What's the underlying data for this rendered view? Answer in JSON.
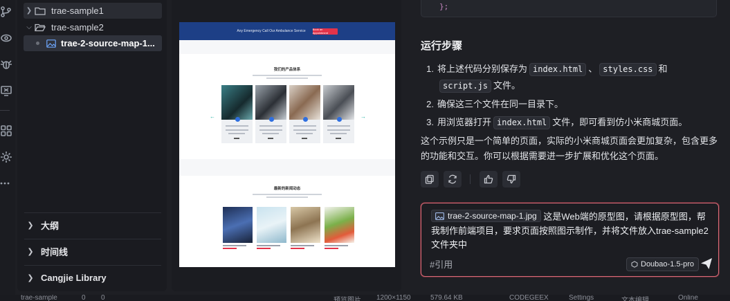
{
  "activity_bar": {
    "icons": [
      "branch-icon",
      "debug-run-icon",
      "bug-icon",
      "remote-icon",
      "extensions-icon",
      "settings-icon",
      "more-icon"
    ]
  },
  "explorer": {
    "items": [
      {
        "label": "trae-sample1",
        "type": "folder",
        "expanded": false
      },
      {
        "label": "trae-sample2",
        "type": "folder",
        "expanded": true
      },
      {
        "label": "trae-2-source-map-1...",
        "type": "image-file",
        "selected": true
      }
    ],
    "sections": [
      {
        "label": "大纲"
      },
      {
        "label": "时间线"
      },
      {
        "label": "Cangjie Library"
      }
    ]
  },
  "preview": {
    "banner_text": "Any Emergency Call Our Ambulance Service",
    "banner_button": "Book an Appointment",
    "products_title": "我们的产品体系",
    "news_title": "最新的新闻动态",
    "product_names": [
      "手术器械系列",
      "听诊器系列",
      "护理器械系列",
      "显微镜系列"
    ],
    "news_names": [
      "Daniel R. Bruce",
      "Clifford S. Holland",
      "Emily R. Shreeves",
      "Sandra A. Naffe"
    ]
  },
  "chat": {
    "code_tail": "};",
    "heading": "运行步骤",
    "steps": [
      {
        "num": "1.",
        "prefix": "将上述代码分别保存为",
        "code1": "index.html",
        "sep1": "、",
        "code2": "styles.css",
        "sep2": "和",
        "code3": "script.js",
        "suffix": "文件。"
      },
      {
        "num": "2.",
        "text": "确保这三个文件在同一目录下。"
      },
      {
        "num": "3.",
        "prefix": "用浏览器打开",
        "code": "index.html",
        "suffix": "文件，即可看到仿小米商城页面。"
      }
    ],
    "summary": "这个示例只是一个简单的页面，实际的小米商城页面会更加复杂，包含更多的功能和交互。你可以根据需要进一步扩展和优化这个页面。",
    "input": {
      "file_chip": "trae-2-source-map-1.jpg",
      "message": "这是Web端的原型图，请根据原型图，帮我制作前端项目，要求页面按照图示制作，并将文件放入trae-sample2文件夹中",
      "ref_label": "#引用",
      "model": "Doubao-1.5-pro"
    }
  },
  "statusbar": {
    "items": [
      "trae-sample",
      "0",
      "0",
      "预览图片",
      "1200×1150",
      "579.64 KB",
      "CODEGEEX",
      "Settings",
      "文本编辑",
      "Online"
    ]
  }
}
